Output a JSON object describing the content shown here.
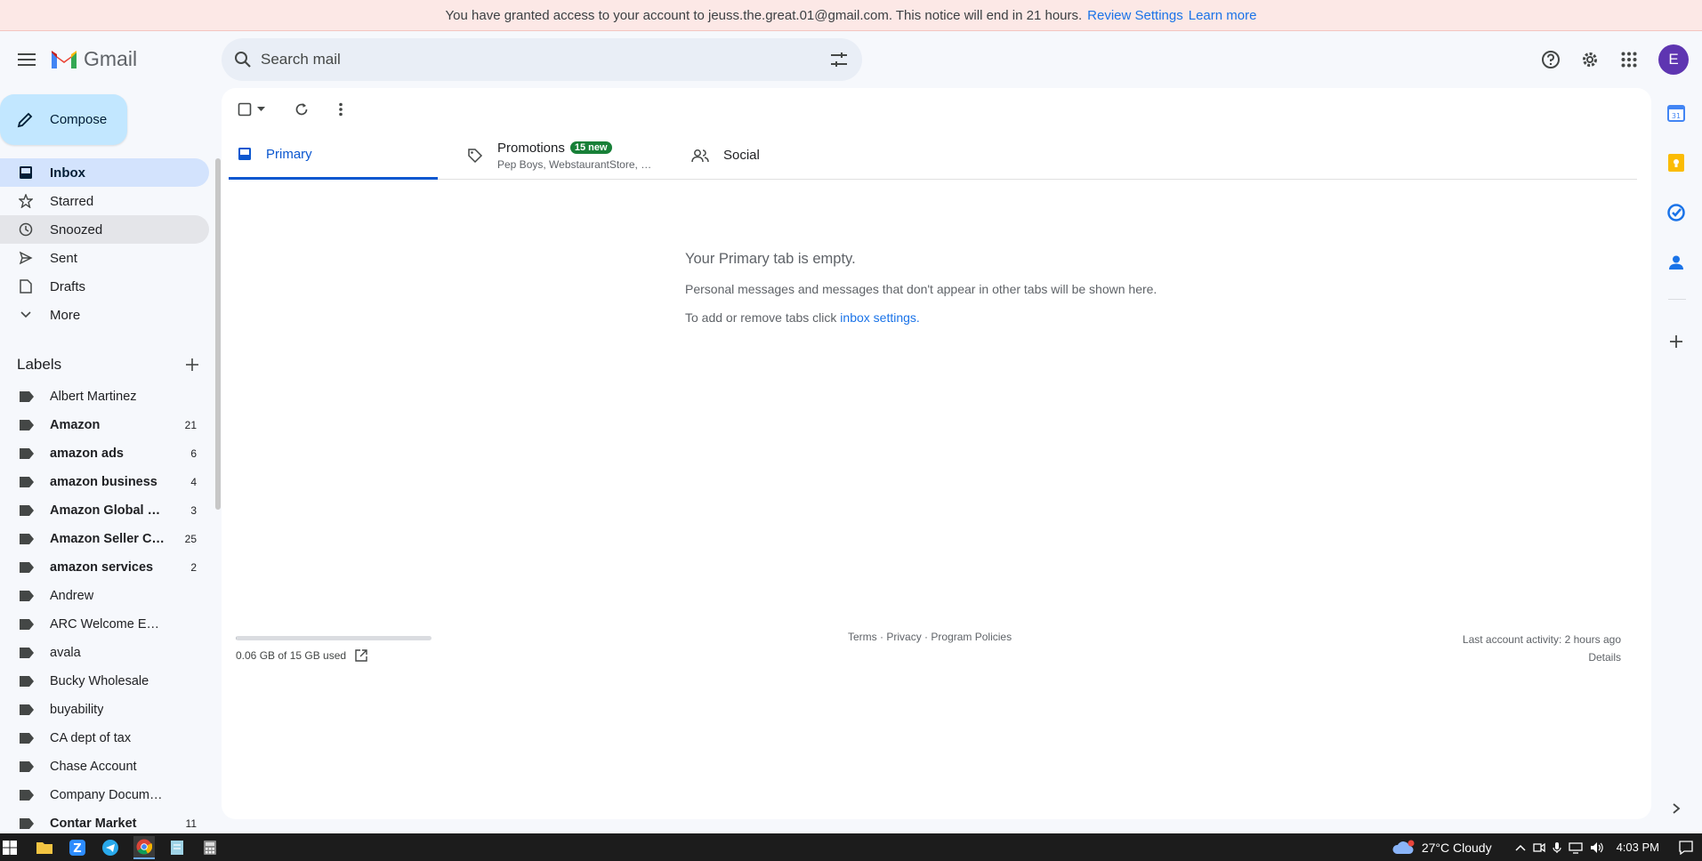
{
  "notice": {
    "text": "You have granted access to your account to jeuss.the.great.01@gmail.com. This notice will end in 21 hours.",
    "review_link": "Review Settings",
    "learn_link": "Learn more"
  },
  "header": {
    "app_name": "Gmail",
    "search_placeholder": "Search mail",
    "avatar_initial": "E"
  },
  "compose_label": "Compose",
  "nav": {
    "items": [
      {
        "label": "Inbox"
      },
      {
        "label": "Starred"
      },
      {
        "label": "Snoozed"
      },
      {
        "label": "Sent"
      },
      {
        "label": "Drafts"
      },
      {
        "label": "More"
      }
    ]
  },
  "labels": {
    "heading": "Labels",
    "items": [
      {
        "name": "Albert Martinez",
        "count": ""
      },
      {
        "name": "Amazon",
        "count": "21"
      },
      {
        "name": "amazon ads",
        "count": "6"
      },
      {
        "name": "amazon business",
        "count": "4"
      },
      {
        "name": "Amazon Global Lo...",
        "count": "3"
      },
      {
        "name": "Amazon Seller Ce...",
        "count": "25"
      },
      {
        "name": "amazon services",
        "count": "2"
      },
      {
        "name": "Andrew",
        "count": ""
      },
      {
        "name": "ARC Welcome Emails",
        "count": ""
      },
      {
        "name": "avala",
        "count": ""
      },
      {
        "name": "Bucky Wholesale",
        "count": ""
      },
      {
        "name": "buyability",
        "count": ""
      },
      {
        "name": "CA dept of tax",
        "count": ""
      },
      {
        "name": "Chase Account",
        "count": ""
      },
      {
        "name": "Company Documents",
        "count": ""
      },
      {
        "name": "Contar Market",
        "count": "11"
      }
    ]
  },
  "tabs": {
    "primary": "Primary",
    "promotions": "Promotions",
    "promotions_badge": "15 new",
    "promotions_senders": "Pep Boys, WebstaurantStore, Gr...",
    "social": "Social"
  },
  "empty_state": {
    "title": "Your Primary tab is empty.",
    "line1": "Personal messages and messages that don't appear in other tabs will be shown here.",
    "line2_prefix": "To add or remove tabs click",
    "line2_link": "inbox settings."
  },
  "footer": {
    "storage": "0.06 GB of 15 GB used",
    "storage_fraction": 0.004,
    "terms": "Terms",
    "privacy": "Privacy",
    "policies": "Program Policies",
    "sep": "·",
    "activity": "Last account activity: 2 hours ago",
    "details": "Details"
  },
  "taskbar": {
    "weather": "27°C  Cloudy",
    "time": "4:03 PM"
  },
  "colors": {
    "accent": "#0b57d0",
    "compose_bg": "#c2e7ff",
    "active_nav": "#d3e3fd",
    "badge": "#188038",
    "notice_bg": "#fce8e6"
  }
}
